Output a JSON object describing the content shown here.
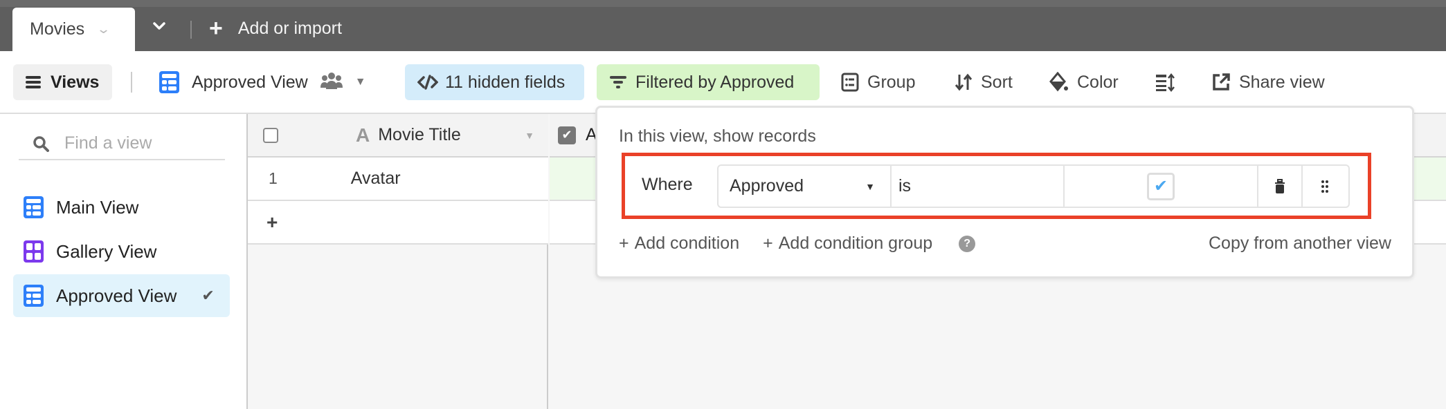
{
  "topbar": {
    "active_table": "Movies",
    "add_import_label": "Add or import"
  },
  "toolbar": {
    "views_label": "Views",
    "current_view": "Approved View",
    "hidden_fields_label": "11 hidden fields",
    "filter_label": "Filtered by Approved",
    "group_label": "Group",
    "sort_label": "Sort",
    "color_label": "Color",
    "share_label": "Share view"
  },
  "sidebar": {
    "search_placeholder": "Find a view",
    "views": [
      {
        "label": "Main View",
        "type": "grid",
        "selected": false
      },
      {
        "label": "Gallery View",
        "type": "gallery",
        "selected": false
      },
      {
        "label": "Approved View",
        "type": "grid",
        "selected": true
      }
    ]
  },
  "grid": {
    "columns": [
      {
        "label": "Movie Title",
        "type": "text"
      },
      {
        "label": "A",
        "type": "checkbox"
      }
    ],
    "rows": [
      {
        "number": "1",
        "title": "Avatar"
      }
    ],
    "add_row_label": "+"
  },
  "filter_popover": {
    "title": "In this view, show records",
    "conditions": [
      {
        "conjunction": "Where",
        "field": "Approved",
        "operator": "is",
        "value_checked": true
      }
    ],
    "add_condition_label": "Add condition",
    "add_group_label": "Add condition group",
    "copy_label": "Copy from another view"
  },
  "colors": {
    "accent_blue": "#2d7ff9",
    "gallery_purple": "#7c39ed",
    "hidden_fields_bg": "#d4ecfa",
    "filter_bg": "#d8f5c8",
    "highlight_red": "#ea4128"
  }
}
